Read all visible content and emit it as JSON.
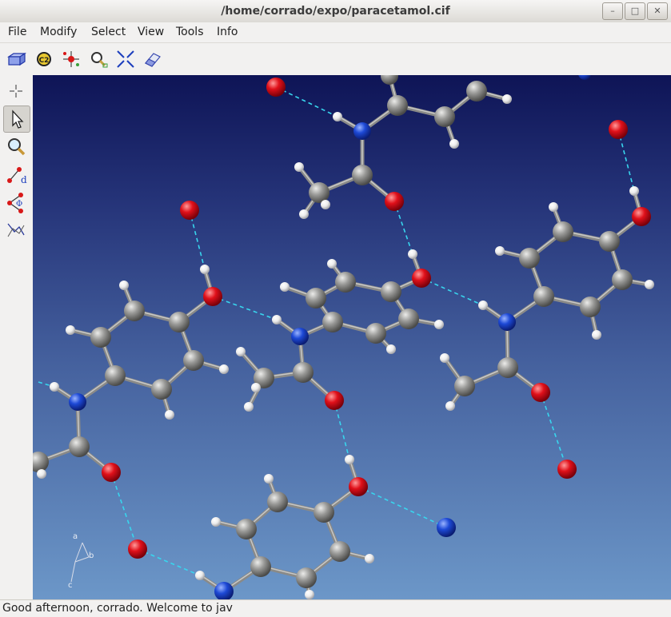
{
  "window": {
    "title": "/home/corrado/expo/paracetamol.cif"
  },
  "menu": {
    "items": [
      "File",
      "Modify",
      "Select",
      "View",
      "Tools",
      "Info"
    ]
  },
  "toolbar": {
    "icons": [
      "cell-box-icon",
      "c2-symmetry-icon",
      "atom-center-icon",
      "zoom-fit-icon",
      "collapse-icon",
      "eraser-icon"
    ]
  },
  "sidebar": {
    "icons": [
      "crosshair-icon",
      "pointer-arrow-icon",
      "magnifier-icon",
      "distance-d-icon",
      "angle-phi-icon",
      "torsion-icon"
    ],
    "active_index": 1
  },
  "axes": {
    "a": "a",
    "b": "b",
    "c": "c"
  },
  "colors": {
    "carbon": "#9a9a98",
    "oxygen": "#e0101a",
    "nitrogen": "#1d49d6",
    "hydrogen": "#f2f2f2",
    "hbond": "#38d6ee"
  },
  "status": {
    "text": "Good afternoon, corrado.  Welcome to jav"
  }
}
